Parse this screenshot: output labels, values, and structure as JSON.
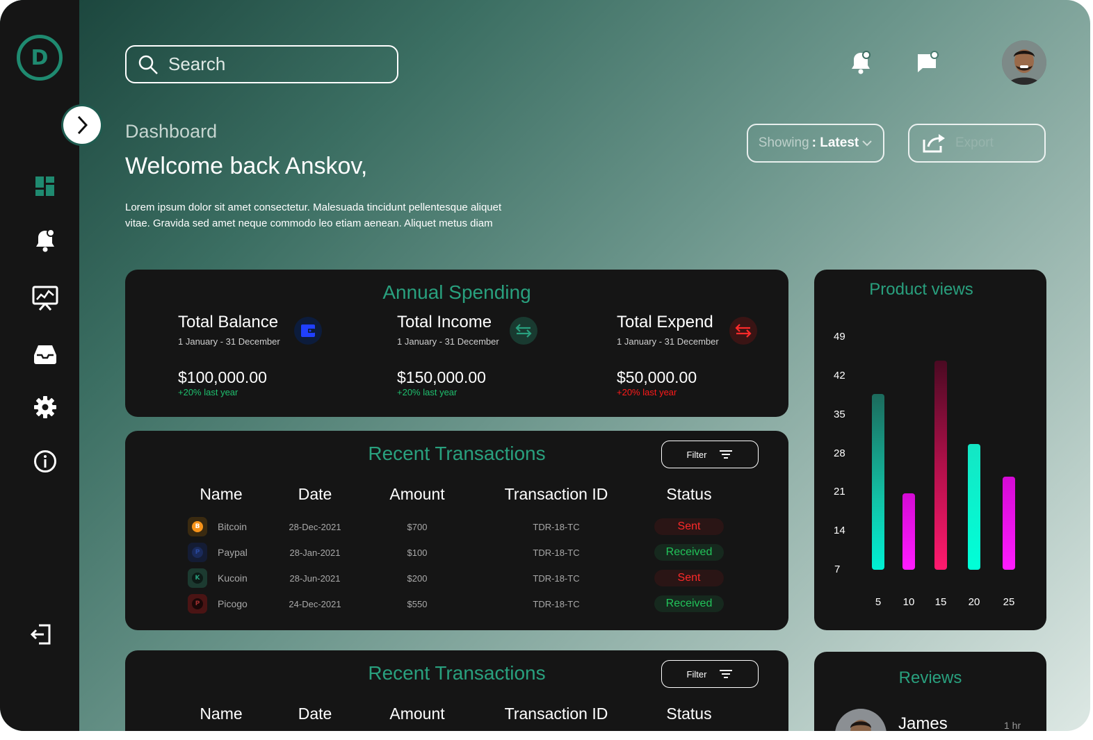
{
  "window": {
    "traffic_lights": [
      {
        "name": "close",
        "color": "#ff5f57"
      },
      {
        "name": "minimize",
        "color": "#febc2e"
      },
      {
        "name": "maximize",
        "color": "#28c840"
      }
    ]
  },
  "sidebar": {
    "logo_letter": "D",
    "items": [
      {
        "name": "dashboard",
        "icon": "dashboard-grid-icon"
      },
      {
        "name": "notifications",
        "icon": "bell-icon"
      },
      {
        "name": "analytics",
        "icon": "presentation-chart-icon"
      },
      {
        "name": "inbox",
        "icon": "inbox-tray-icon"
      },
      {
        "name": "settings",
        "icon": "gear-icon"
      },
      {
        "name": "info",
        "icon": "info-icon"
      }
    ],
    "logout_icon": "logout-icon"
  },
  "header": {
    "search_placeholder": "Search",
    "breadcrumb": "Dashboard",
    "welcome": "Welcome back Anskov,",
    "intro": "Lorem ipsum dolor sit amet consectetur. Malesuada tincidunt pellentesque aliquet vitae. Gravida sed amet neque commodo leo etiam aenean. Aliquet metus diam",
    "showing_label": "Showing",
    "showing_value": ": Latest",
    "export_label": "Export"
  },
  "colors": {
    "accent": "#29a07e",
    "positive": "#1fbf6e",
    "negative": "#ff1a1a",
    "card_bg": "#151515"
  },
  "annual": {
    "title": "Annual Spending",
    "stats": [
      {
        "label": "Total Balance",
        "range": "1 January - 31 December",
        "amount": "$100,000.00",
        "change": "+20% last year",
        "trend": "positive",
        "icon": "wallet-icon"
      },
      {
        "label": "Total Income",
        "range": "1 January - 31 December",
        "amount": "$150,000.00",
        "change": "+20% last year",
        "trend": "positive",
        "icon": "transfer-arrows-icon"
      },
      {
        "label": "Total Expend",
        "range": "1 January - 31 December",
        "amount": "$50,000.00",
        "change": "+20% last year",
        "trend": "negative",
        "icon": "transfer-arrows-icon"
      }
    ]
  },
  "transactions": {
    "title": "Recent Transactions",
    "filter_label": "Filter",
    "columns": [
      "Name",
      "Date",
      "Amount",
      "Transaction ID",
      "Status"
    ],
    "rows": [
      {
        "name": "Bitcoin",
        "date": "28-Dec-2021",
        "amount": "$700",
        "id": "TDR-18-TC",
        "status": "Sent",
        "coin_letter": "B"
      },
      {
        "name": "Paypal",
        "date": "28-Jan-2021",
        "amount": "$100",
        "id": "TDR-18-TC",
        "status": "Received",
        "coin_letter": "P"
      },
      {
        "name": "Kucoin",
        "date": "28-Jun-2021",
        "amount": "$200",
        "id": "TDR-18-TC",
        "status": "Sent",
        "coin_letter": "K"
      },
      {
        "name": "Picogo",
        "date": "24-Dec-2021",
        "amount": "$550",
        "id": "TDR-18-TC",
        "status": "Received",
        "coin_letter": "P"
      }
    ]
  },
  "transactions2": {
    "title": "Recent Transactions",
    "filter_label": "Filter",
    "columns": [
      "Name",
      "Date",
      "Amount",
      "Transaction ID",
      "Status"
    ]
  },
  "chart_data": {
    "type": "bar",
    "title": "Product views",
    "categories": [
      "5",
      "10",
      "15",
      "20",
      "25"
    ],
    "values": [
      39,
      21,
      45,
      30,
      24
    ],
    "bar_colors": [
      "teal-to-cyan",
      "magenta",
      "maroon-to-pink",
      "cyan",
      "magenta"
    ],
    "yticks": [
      49,
      42,
      35,
      28,
      21,
      14,
      7
    ],
    "ylim": [
      6,
      49
    ],
    "grid": false
  },
  "reviews": {
    "title": "Reviews",
    "first_reviewer": "James",
    "first_time": "1 hr"
  }
}
